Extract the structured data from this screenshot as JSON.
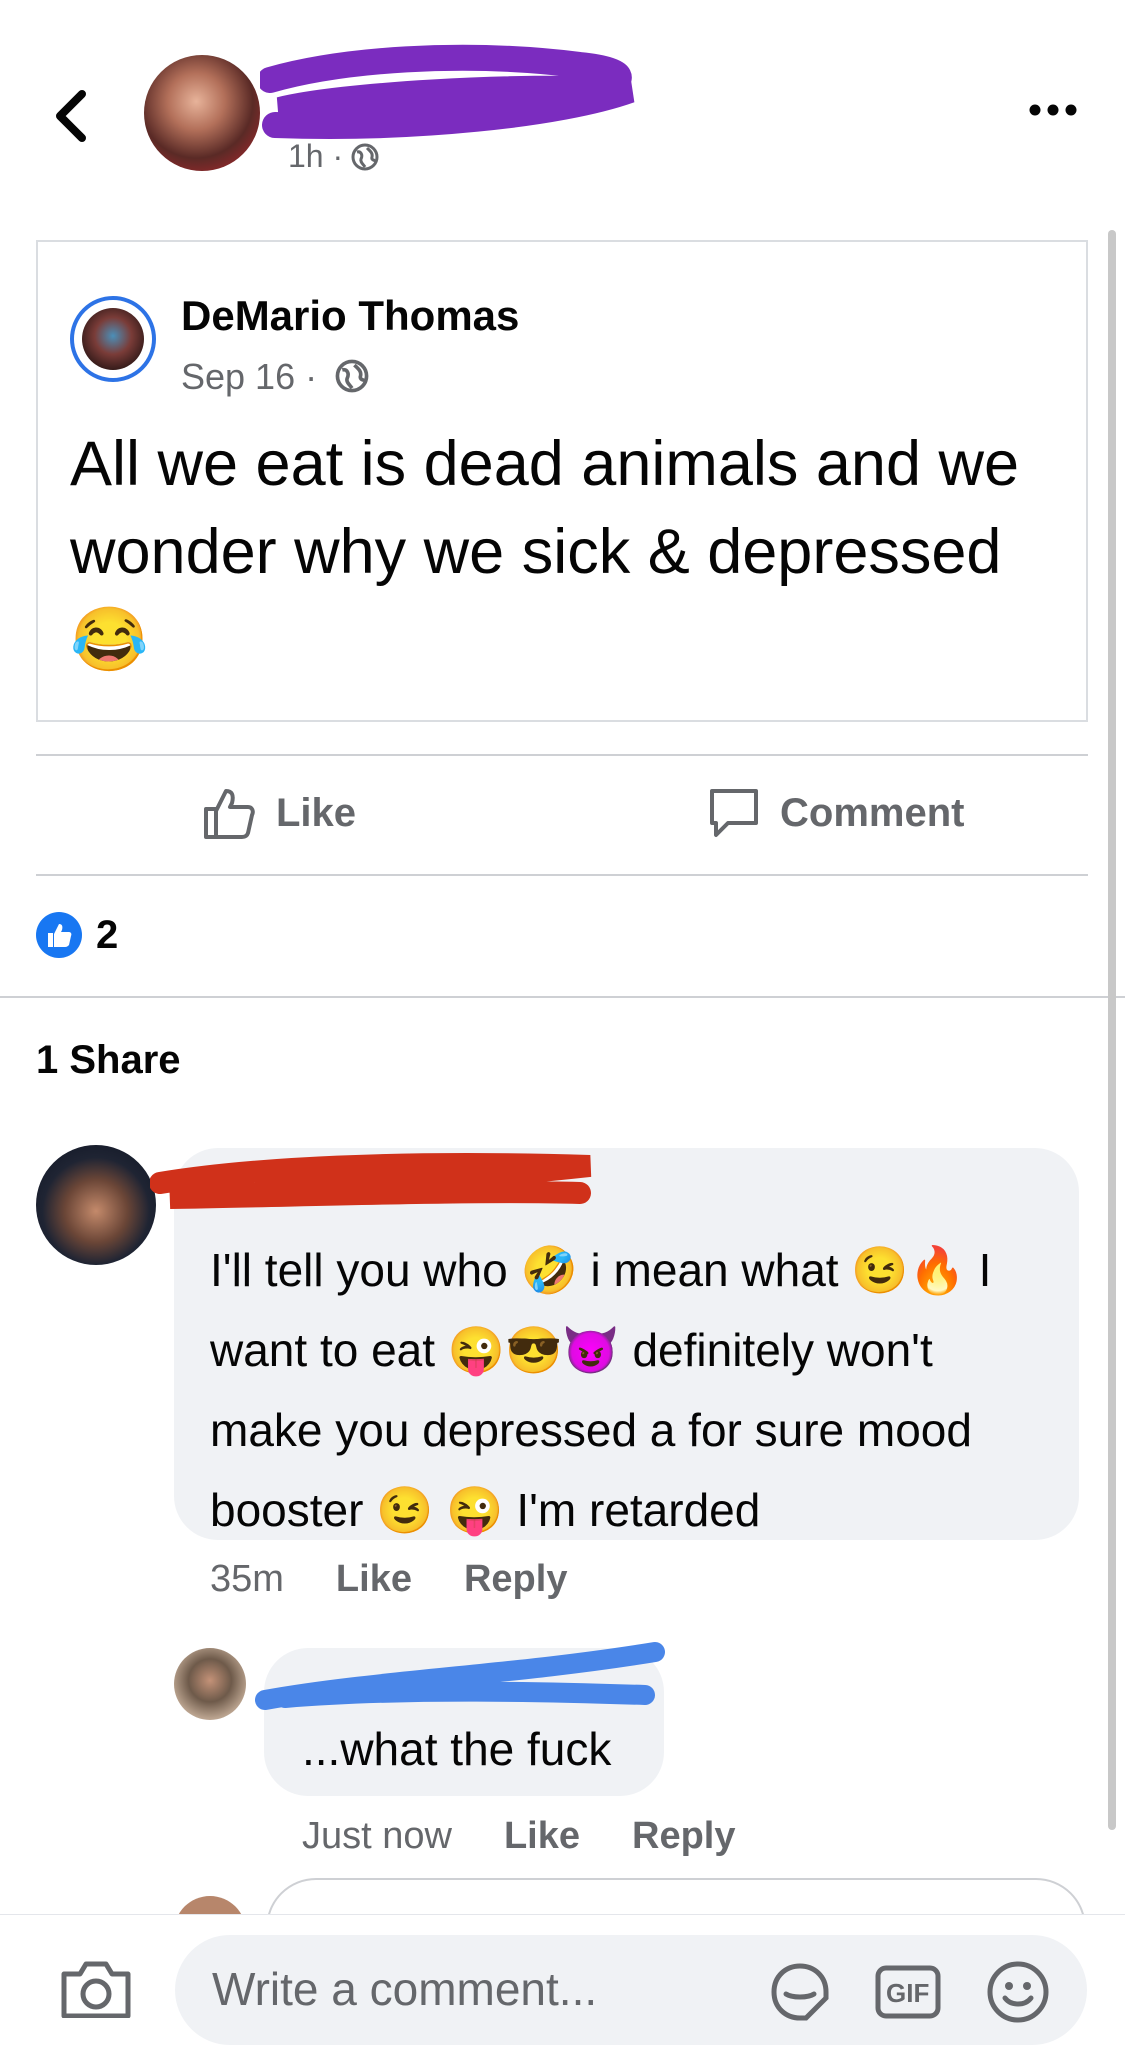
{
  "header": {
    "time": "1h ·"
  },
  "shared_post": {
    "author": "DeMario Thomas",
    "date": "Sep 16 ·",
    "text": "All we eat is dead animals and we wonder why we sick & depressed",
    "emoji": "😂"
  },
  "actions": {
    "like_label": "Like",
    "comment_label": "Comment"
  },
  "stats": {
    "like_count": "2",
    "shares": "1 Share"
  },
  "comments": [
    {
      "lines": [
        {
          "parts": [
            "I'll tell you who ",
            "🤣",
            " i mean what ",
            "😉",
            "🔥",
            " I"
          ]
        },
        {
          "parts": [
            "want to eat ",
            "😜",
            "😎",
            "😈",
            " definitely won't"
          ]
        },
        {
          "parts": [
            "make you depressed a for sure mood"
          ]
        },
        {
          "parts": [
            "booster ",
            "😉",
            " ",
            "😜",
            " I'm retarded"
          ]
        }
      ],
      "time": "35m",
      "like": "Like",
      "reply": "Reply"
    },
    {
      "text": "...what the fuck",
      "time": "Just now",
      "like": "Like",
      "reply": "Reply"
    }
  ],
  "composer": {
    "placeholder": "Write a comment...",
    "icons": [
      "camera-icon",
      "sticker-icon",
      "gif-icon",
      "emoji-icon"
    ],
    "gif_label": "GIF"
  },
  "colors": {
    "accent": "#1877f2",
    "secondary_text": "#65676b",
    "bubble": "#f0f2f5",
    "redact_purple": "#7b2cbf",
    "redact_red": "#d0311a",
    "redact_blue": "#4a86e8"
  }
}
